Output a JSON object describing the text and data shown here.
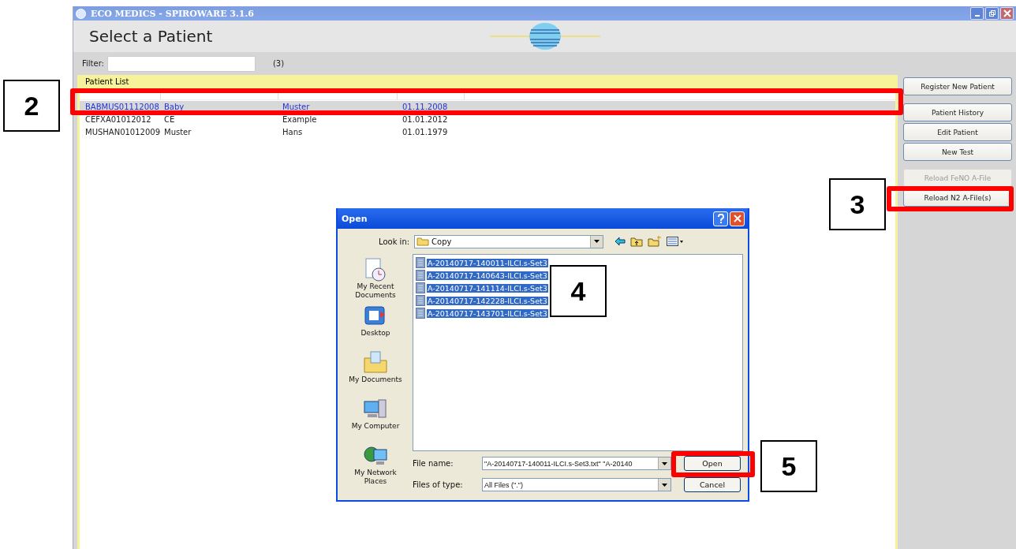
{
  "window": {
    "title": "ECO MEDICS - SPIROWARE 3.1.6"
  },
  "header": {
    "title": "Select a Patient"
  },
  "filter": {
    "label": "Filter:",
    "count": "(3)"
  },
  "patient_list": {
    "title": "Patient List",
    "rows": [
      {
        "cells": [
          "BABMUS01112008",
          "Baby",
          "Muster",
          "01.11.2008"
        ],
        "selected": true
      },
      {
        "cells": [
          "CEFXA01012012",
          "CE",
          "Example",
          "01.01.2012"
        ],
        "selected": false
      },
      {
        "cells": [
          "MUSHAN01012009",
          "Muster",
          "Hans",
          "01.01.1979"
        ],
        "selected": false
      }
    ]
  },
  "actions": [
    {
      "label": "Register New Patient",
      "disabled": false
    },
    {
      "label": "Patient History",
      "disabled": false
    },
    {
      "label": "Edit Patient",
      "disabled": false
    },
    {
      "label": "New Test",
      "disabled": false
    },
    {
      "label": "Reload FeNO A-File",
      "disabled": true
    },
    {
      "label": "Reload N2 A-File(s)",
      "disabled": false
    }
  ],
  "open_dialog": {
    "title": "Open",
    "look_in_label": "Look in:",
    "look_in": "Copy",
    "places": [
      {
        "label": "My Recent Documents",
        "kind": "recent"
      },
      {
        "label": "Desktop",
        "kind": "desktop"
      },
      {
        "label": "My Documents",
        "kind": "documents"
      },
      {
        "label": "My Computer",
        "kind": "computer"
      },
      {
        "label": "My Network Places",
        "kind": "network"
      }
    ],
    "files": [
      {
        "name": "A-20140717-140011-ILCI.s-Set3",
        "selected": true
      },
      {
        "name": "A-20140717-140643-ILCI.s-Set3",
        "selected": true
      },
      {
        "name": "A-20140717-141114-ILCI.s-Set3",
        "selected": true
      },
      {
        "name": "A-20140717-142228-ILCI.s-Set3",
        "selected": true
      },
      {
        "name": "A-20140717-143701-ILCI.s-Set3",
        "selected": true
      }
    ],
    "file_name_label": "File name:",
    "file_name": "\"A-20140717-140011-ILCI.s-Set3.txt\" \"A-20140",
    "file_type_label": "Files of type:",
    "file_type": "All Files (\".\")",
    "buttons": [
      "Open",
      "Cancel"
    ]
  },
  "callouts": [
    "2",
    "3",
    "4",
    "5"
  ]
}
